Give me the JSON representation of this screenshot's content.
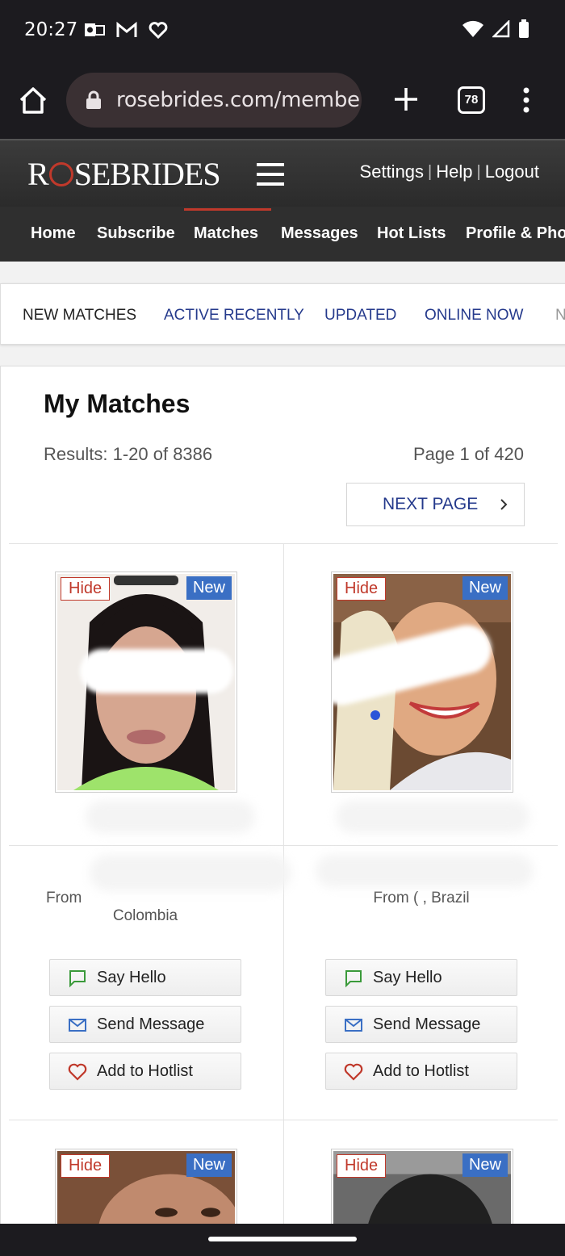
{
  "status": {
    "time": "20:27"
  },
  "browser": {
    "url": "rosebrides.com/membe",
    "tab_count": "78"
  },
  "site": {
    "logo_left": "R",
    "logo_right": "SEBRIDES",
    "links": [
      "Settings",
      "Help",
      "Logout"
    ]
  },
  "nav": {
    "items": [
      "Home",
      "Subscribe",
      "Matches",
      "Messages",
      "Hot Lists",
      "Profile & Pho"
    ],
    "active": "Matches"
  },
  "subtabs": [
    "NEW MATCHES",
    "ACTIVE RECENTLY",
    "UPDATED",
    "ONLINE NOW",
    "N"
  ],
  "page": {
    "title": "My Matches",
    "results": "Results: 1-20 of 8386",
    "page_info": "Page 1 of 420",
    "next_label": "NEXT PAGE"
  },
  "cards": [
    {
      "hide": "Hide",
      "new": "New",
      "from_line1": "From",
      "from_line2": "Colombia",
      "say_hello": "Say Hello",
      "send_message": "Send Message",
      "add_hotlist": "Add to Hotlist"
    },
    {
      "hide": "Hide",
      "new": "New",
      "from_line1": "From ( , Brazil",
      "say_hello": "Say Hello",
      "send_message": "Send Message",
      "add_hotlist": "Add to Hotlist"
    },
    {
      "hide": "Hide",
      "new": "New"
    },
    {
      "hide": "Hide",
      "new": "New"
    }
  ],
  "colors": {
    "accent_red": "#c0392b",
    "link_blue": "#253a8c",
    "badge_blue": "#3a6fc4"
  }
}
